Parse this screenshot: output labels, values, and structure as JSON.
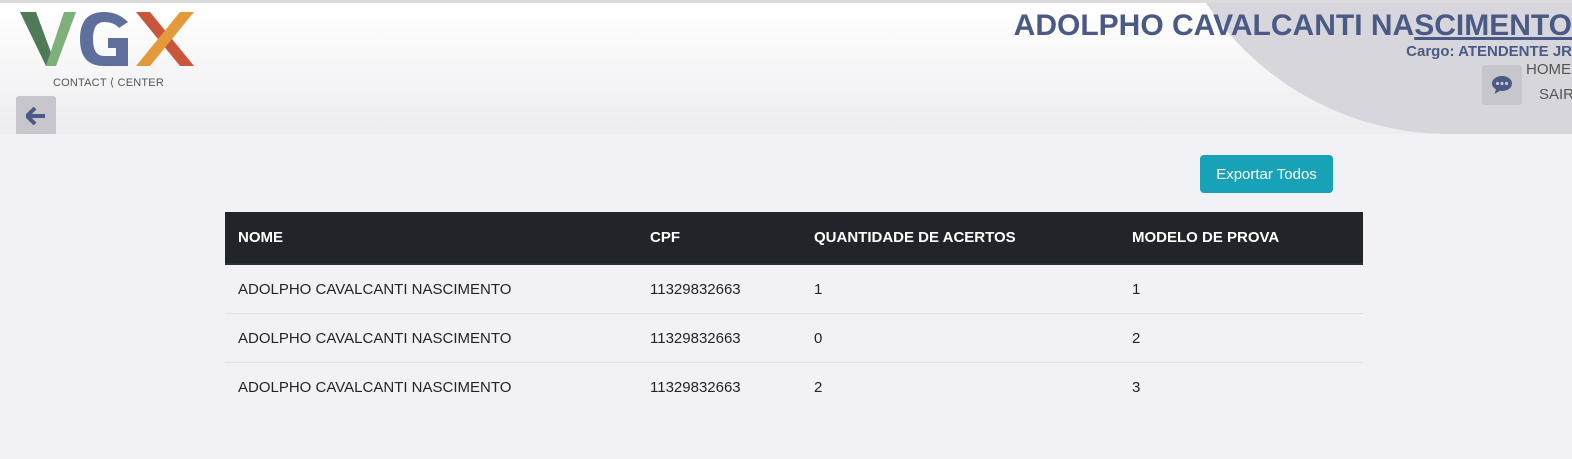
{
  "logo": {
    "letters": [
      "V",
      "G",
      "X"
    ],
    "subtitle": "CONTACT ⟨ CENTER",
    "colors": {
      "v_dark": "#4e7a55",
      "v_light": "#7fb07a",
      "g": "#5d6f9a",
      "x_orange": "#e39a3a",
      "x_red": "#c8563a"
    }
  },
  "header": {
    "user_name_plain": "ADOLPHO CAVALCANTI NA",
    "user_name_underlined": "SCIMENTO",
    "role_line": "Cargo: ATENDENTE JR",
    "nav_home": "HOME",
    "nav_sair": "SAIR",
    "back_icon": "arrow-left-icon",
    "chat_icon": "chat-bubble-icon"
  },
  "actions": {
    "export_label": "Exportar Todos"
  },
  "table": {
    "columns": [
      "NOME",
      "CPF",
      "QUANTIDADE DE ACERTOS",
      "MODELO DE PROVA"
    ],
    "rows": [
      [
        "ADOLPHO CAVALCANTI NASCIMENTO",
        "11329832663",
        "1",
        "1"
      ],
      [
        "ADOLPHO CAVALCANTI NASCIMENTO",
        "11329832663",
        "0",
        "2"
      ],
      [
        "ADOLPHO CAVALCANTI NASCIMENTO",
        "11329832663",
        "2",
        "3"
      ]
    ]
  },
  "colors": {
    "accent": "#17a2b8",
    "header_text": "#4a5a84",
    "table_head": "#212529",
    "page_bg": "#f2f1f6"
  }
}
